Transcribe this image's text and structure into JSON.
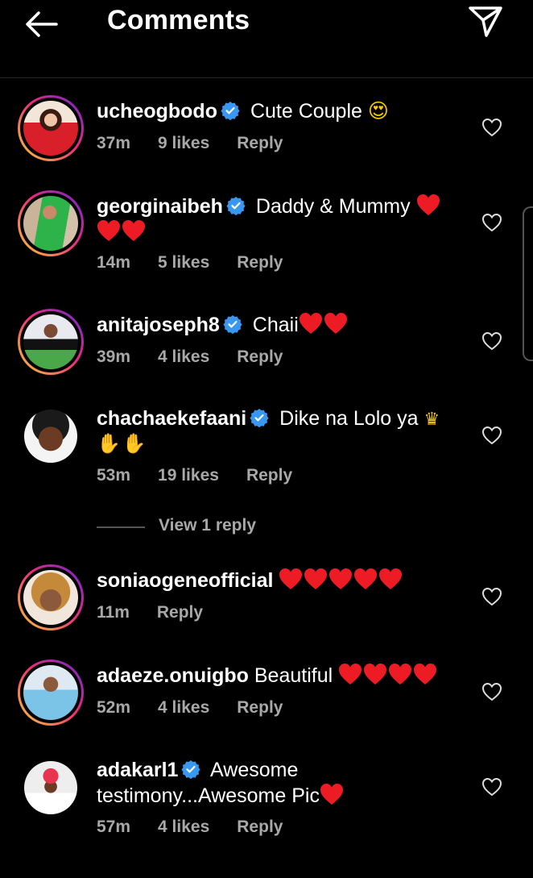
{
  "header": {
    "title": "Comments"
  },
  "comments": [
    {
      "user": "ucheogbodo",
      "text": "Cute Couple",
      "emoji": "😍",
      "time": "37m",
      "likes": "9 likes",
      "reply": "Reply"
    },
    {
      "user": "georginaibeh",
      "text": "Daddy & Mummy",
      "emoji": "❤️❤️❤️",
      "time": "14m",
      "likes": "5 likes",
      "reply": "Reply"
    },
    {
      "user": "anitajoseph8",
      "text": "Chaii",
      "emoji": "❤️❤️",
      "time": "39m",
      "likes": "4 likes",
      "reply": "Reply"
    },
    {
      "user": "chachaekefaani",
      "text": "Dike na Lolo ya",
      "emoji": "👑🙌🏿🙌🏿",
      "time": "53m",
      "likes": "19 likes",
      "reply": "Reply"
    },
    {
      "user": "soniaogeneofficial",
      "text": "",
      "emoji": "❤️❤️❤️❤️❤️",
      "time": "11m",
      "reply": "Reply"
    },
    {
      "user": "adaeze.onuigbo",
      "text": "Beautiful",
      "emoji": "❤️❤️❤️❤️",
      "time": "52m",
      "likes": "4 likes",
      "reply": "Reply"
    },
    {
      "user": "adakarl1",
      "text": "Awesome testimony...Awesome Pic",
      "emoji": "❤️",
      "time": "57m",
      "likes": "4 likes",
      "reply": "Reply"
    }
  ],
  "view_replies": "View 1 reply",
  "colors": {
    "background": "#000000",
    "meta": "#a8a8a8",
    "verified": "#3897f0",
    "heart": "#ed1c24"
  }
}
